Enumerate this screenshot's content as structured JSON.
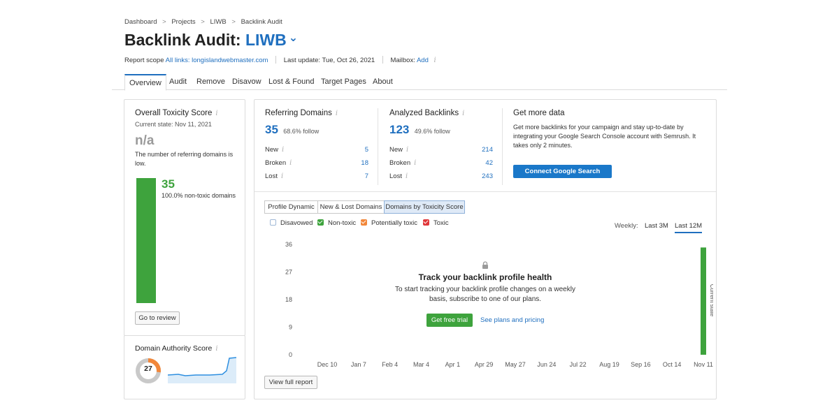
{
  "breadcrumb": [
    "Dashboard",
    "Projects",
    "LIWB",
    "Backlink Audit"
  ],
  "breadcrumb_sep": ">",
  "title": {
    "prefix": "Backlink Audit:",
    "project": "LIWB",
    "chevron": "⌄"
  },
  "meta": {
    "scope_label": "Report scope",
    "scope_value": "All links: longislandwebmaster.com",
    "last_update": "Last update: Tue, Oct 26, 2021",
    "mailbox_label": "Mailbox:",
    "mailbox_action": "Add",
    "info_glyph": "i"
  },
  "tabs": [
    "Overview",
    "Audit",
    "Remove",
    "Disavow",
    "Lost & Found",
    "Target Pages",
    "About"
  ],
  "toxicity": {
    "title": "Overall Toxicity Score",
    "current_state": "Current state: Nov 11, 2021",
    "score": "n/a",
    "description": "The number of referring domains is low.",
    "count": "35",
    "percent_label": "100.0% non-toxic domains",
    "non_toxic_share": 1.0,
    "review_button": "Go to review"
  },
  "authority": {
    "title": "Domain Authority Score",
    "score": "27",
    "score_value": 27
  },
  "referring": {
    "title": "Referring Domains",
    "value": "35",
    "follow": "68.6% follow",
    "rows": [
      {
        "label": "New",
        "value": "5"
      },
      {
        "label": "Broken",
        "value": "18"
      },
      {
        "label": "Lost",
        "value": "7"
      }
    ]
  },
  "backlinks": {
    "title": "Analyzed Backlinks",
    "value": "123",
    "follow": "49.6% follow",
    "rows": [
      {
        "label": "New",
        "value": "214"
      },
      {
        "label": "Broken",
        "value": "42"
      },
      {
        "label": "Lost",
        "value": "243"
      }
    ]
  },
  "get_more": {
    "title": "Get more data",
    "text": "Get more backlinks for your campaign and stay up-to-date by integrating your Google Search Console account with Semrush. It takes only 2 minutes.",
    "button": "Connect Google Search Console"
  },
  "segments": [
    "Profile Dynamic",
    "New & Lost Domains",
    "Domains by Toxicity Score"
  ],
  "legend": [
    {
      "label": "Disavowed",
      "color": "#ffffff",
      "checked": false
    },
    {
      "label": "Non-toxic",
      "color": "#3ea33d",
      "checked": true
    },
    {
      "label": "Potentially toxic",
      "color": "#f2873a",
      "checked": true
    },
    {
      "label": "Toxic",
      "color": "#e0383b",
      "checked": true
    }
  ],
  "period": {
    "label": "Weekly:",
    "options": [
      "Last 3M",
      "Last 12M"
    ],
    "active": "Last 12M"
  },
  "overlay": {
    "lock_icon": "lock-icon",
    "title": "Track your backlink profile health",
    "text_line1": "To start tracking your backlink profile changes on a weekly",
    "text_line2": "basis, subscribe to one of our plans.",
    "trial_button": "Get free trial",
    "plans_link": "See plans and pricing"
  },
  "full_report_button": "View full report",
  "chart_data": {
    "type": "bar",
    "categories": [
      "Dec 10",
      "Jan 7",
      "Feb 4",
      "Mar 4",
      "Apr 1",
      "Apr 29",
      "May 27",
      "Jun 24",
      "Jul 22",
      "Aug 19",
      "Sep 16",
      "Oct 14",
      "Nov 11"
    ],
    "series": [
      {
        "name": "Non-toxic",
        "color": "#3ea33d",
        "values": [
          0,
          0,
          0,
          0,
          0,
          0,
          0,
          0,
          0,
          0,
          0,
          0,
          35
        ]
      }
    ],
    "yticks": [
      36,
      27,
      18,
      9,
      0
    ],
    "ylim": [
      0,
      36
    ],
    "annotation": "Current state",
    "grid": false
  }
}
